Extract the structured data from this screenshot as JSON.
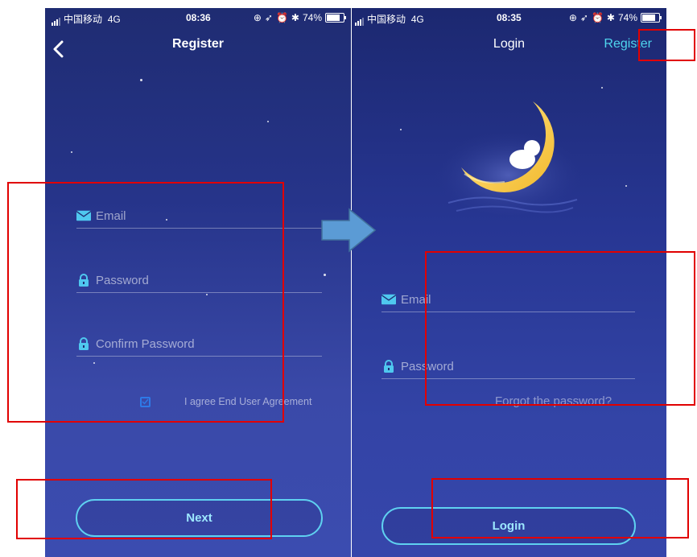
{
  "register_screen": {
    "status_bar": {
      "carrier": "中国移动",
      "network": "4G",
      "time": "08:36",
      "battery": "74%"
    },
    "title": "Register",
    "email_placeholder": "Email",
    "password_placeholder": "Password",
    "confirm_password_placeholder": "Confirm Password",
    "agreement_text": "I agree End User Agreement",
    "agreement_checked": true,
    "next_label": "Next"
  },
  "login_screen": {
    "status_bar": {
      "carrier": "中国移动",
      "network": "4G",
      "time": "08:35",
      "battery": "74%"
    },
    "title": "Login",
    "register_label": "Register",
    "email_placeholder": "Email",
    "password_placeholder": "Password",
    "forgot_label": "Forgot the password?",
    "login_label": "Login"
  },
  "colors": {
    "accent": "#5fd1f0",
    "register_link": "#4fd6ee",
    "highlight_border": "#e10000",
    "arrow": "#5b9bd5",
    "background_top": "#1f2c72",
    "background_bottom": "#3b4cb0"
  },
  "icons": [
    "back-chevron-icon",
    "envelope-icon",
    "lock-icon",
    "checkbox-icon",
    "moon-illustration",
    "flow-arrow-icon"
  ]
}
